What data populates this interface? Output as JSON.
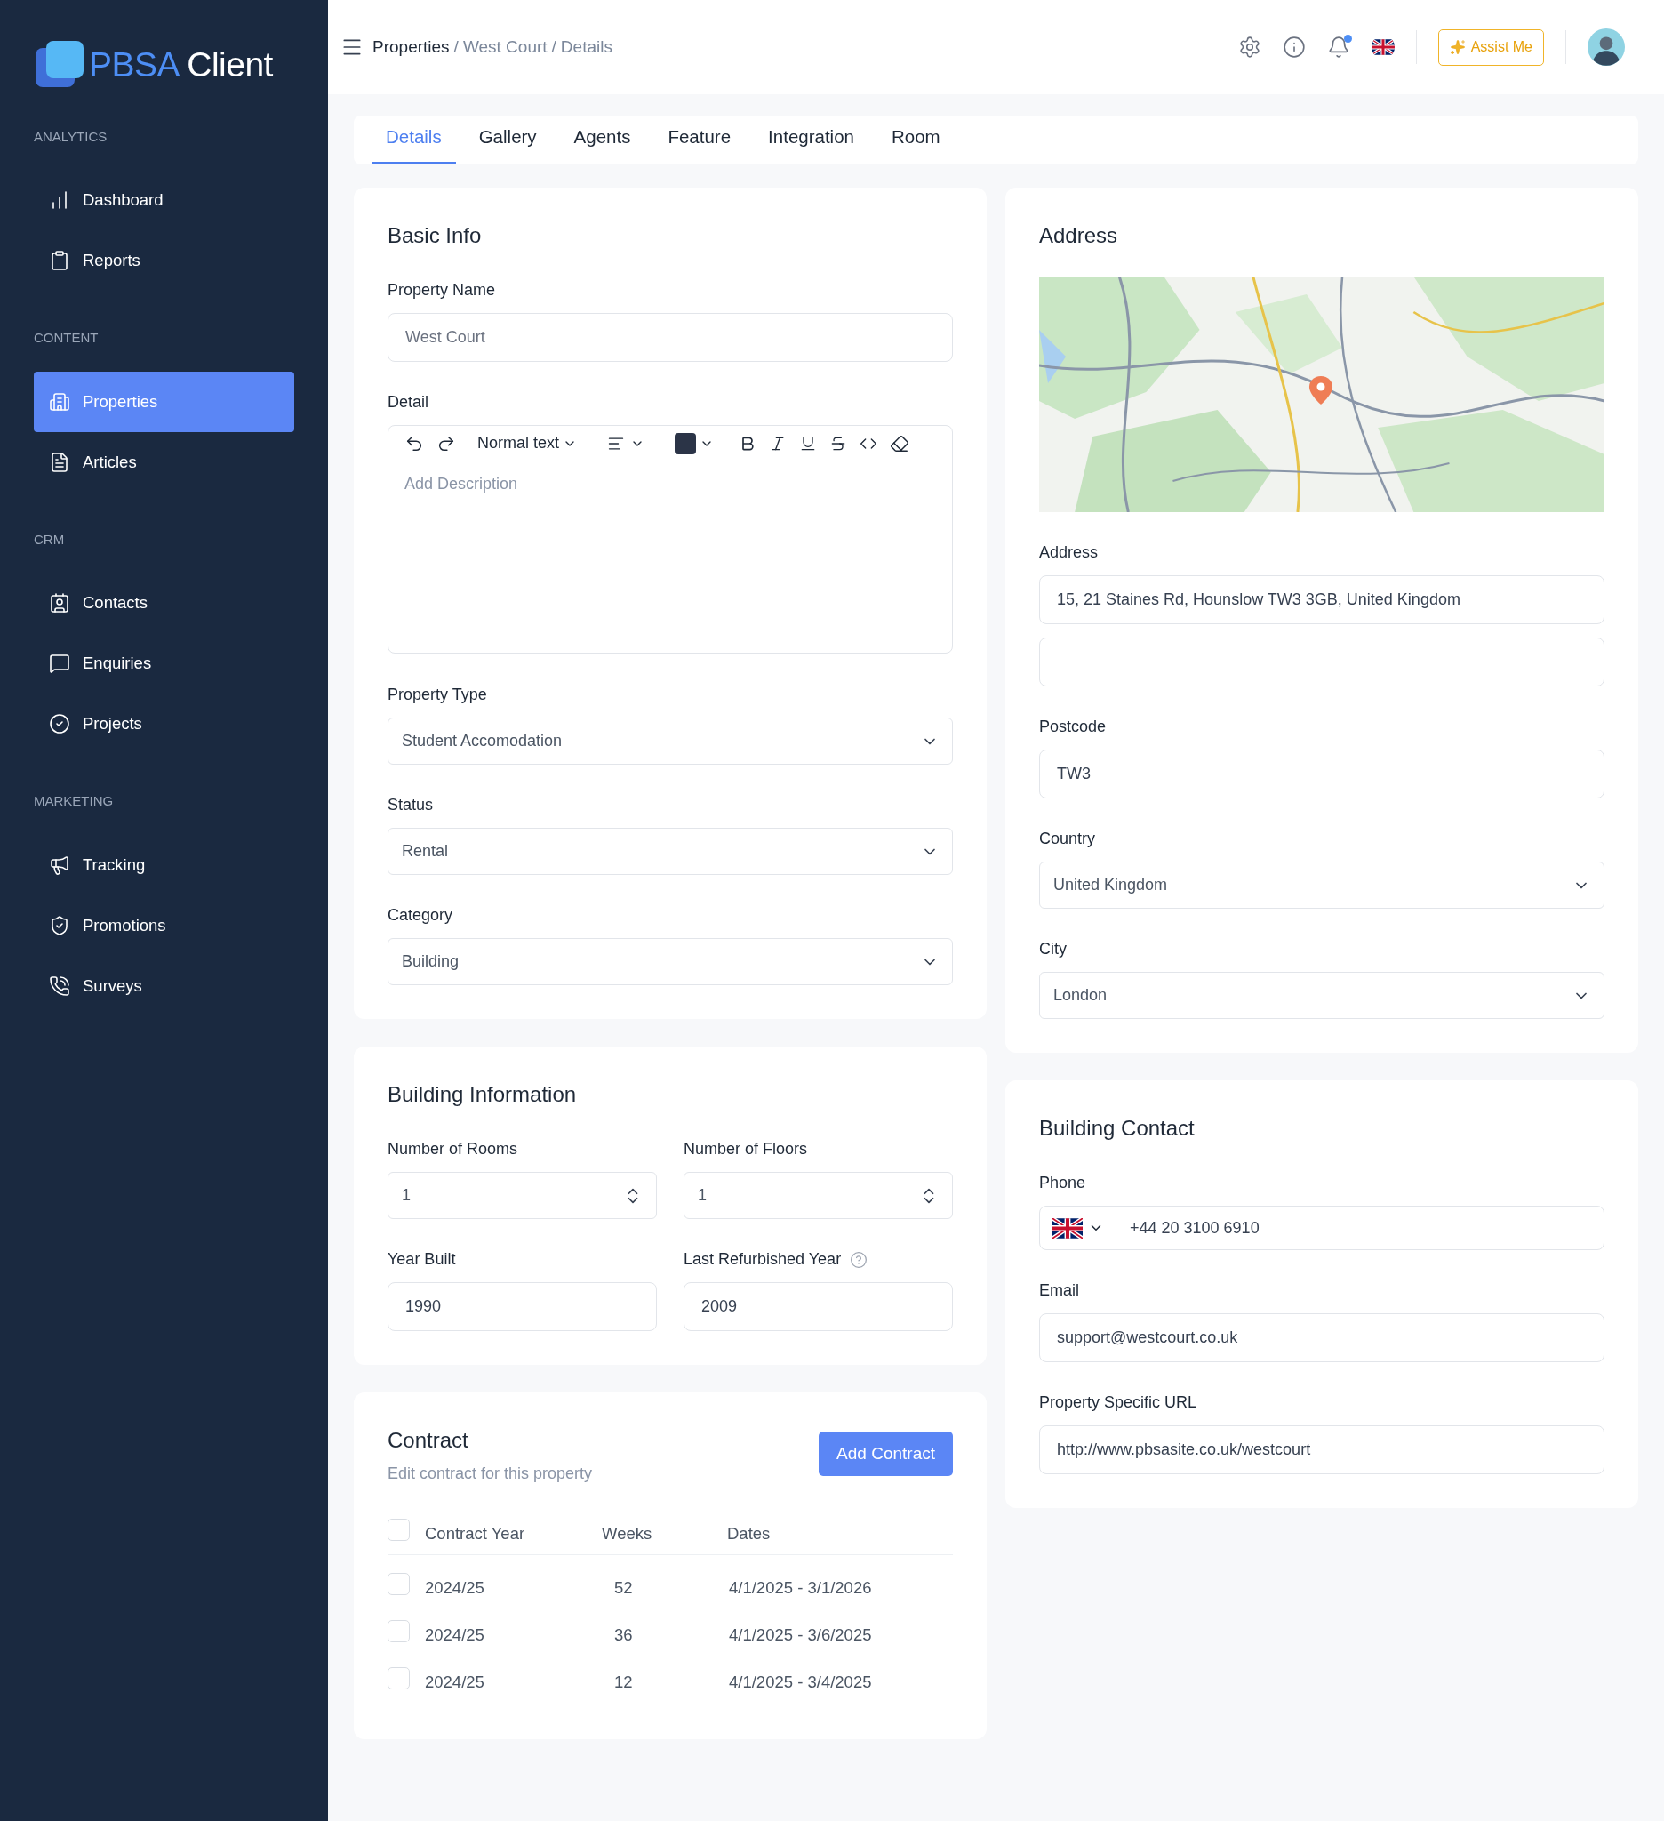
{
  "logo": {
    "primary": "PBSA",
    "secondary": "Client"
  },
  "sidebar": {
    "sections": [
      {
        "title": "ANALYTICS",
        "items": [
          {
            "label": "Dashboard",
            "selected": false
          },
          {
            "label": "Reports",
            "selected": false
          }
        ]
      },
      {
        "title": "CONTENT",
        "items": [
          {
            "label": "Properties",
            "selected": true
          },
          {
            "label": "Articles",
            "selected": false
          }
        ]
      },
      {
        "title": "CRM",
        "items": [
          {
            "label": "Contacts",
            "selected": false
          },
          {
            "label": "Enquiries",
            "selected": false
          },
          {
            "label": "Projects",
            "selected": false
          }
        ]
      },
      {
        "title": "MARKETING",
        "items": [
          {
            "label": "Tracking",
            "selected": false
          },
          {
            "label": "Promotions",
            "selected": false
          },
          {
            "label": "Surveys",
            "selected": false
          }
        ]
      }
    ]
  },
  "topbar": {
    "breadcrumb": [
      "Properties",
      "West Court",
      "Details"
    ],
    "breadcrumb_separator": "/",
    "notifications_unread": true,
    "assist_label": "Assist Me"
  },
  "tabs": [
    {
      "label": "Details",
      "selected": true
    },
    {
      "label": "Gallery",
      "selected": false
    },
    {
      "label": "Agents",
      "selected": false
    },
    {
      "label": "Feature",
      "selected": false
    },
    {
      "label": "Integration",
      "selected": false
    },
    {
      "label": "Room",
      "selected": false
    }
  ],
  "basic_info": {
    "title": "Basic Info",
    "property_name": {
      "label": "Property Name",
      "placeholder": "West Court"
    },
    "detail": {
      "label": "Detail",
      "block_style": "Normal text",
      "placeholder": "Add Description"
    },
    "selects": [
      {
        "label": "Property Type",
        "value": "Student Accomodation"
      },
      {
        "label": "Status",
        "value": "Rental"
      },
      {
        "label": "Category",
        "value": "Building"
      }
    ]
  },
  "building_information": {
    "title": "Building Information",
    "fields": [
      {
        "kind": "number",
        "label": "Number of Rooms",
        "value": "1"
      },
      {
        "kind": "number",
        "label": "Number of Floors",
        "value": "1"
      },
      {
        "kind": "text",
        "label": "Year Built",
        "value": "1990",
        "help": false
      },
      {
        "kind": "text",
        "label": "Last Refurbished Year",
        "value": "2009",
        "help": true
      }
    ]
  },
  "contract": {
    "title": "Contract",
    "subtitle": "Edit contract for this property",
    "button": "Add Contract",
    "all_checked": false,
    "columns": [
      "Contract Year",
      "Weeks",
      "Dates"
    ],
    "rows": [
      {
        "year": "2024/25",
        "weeks": "52",
        "dates": "4/1/2025 - 3/1/2026",
        "checked": false
      },
      {
        "year": "2024/25",
        "weeks": "36",
        "dates": "4/1/2025 - 3/6/2025",
        "checked": false
      },
      {
        "year": "2024/25",
        "weeks": "12",
        "dates": "4/1/2025 - 3/4/2025",
        "checked": false
      }
    ]
  },
  "address": {
    "title": "Address",
    "address_label": "Address",
    "address_lines": [
      {
        "value": "15, 21 Staines Rd, Hounslow TW3 3GB, United Kingdom"
      }
    ],
    "extra_blank_line": true,
    "postcode": {
      "label": "Postcode",
      "value": "TW3"
    },
    "selects": [
      {
        "label": "Country",
        "value": "United Kingdom"
      },
      {
        "label": "City",
        "value": "London"
      }
    ]
  },
  "building_contact": {
    "title": "Building Contact",
    "phone": {
      "label": "Phone",
      "value": "+44 20 3100 6910"
    },
    "email": {
      "label": "Email",
      "value": "support@westcourt.co.uk"
    },
    "url": {
      "label": "Property Specific URL",
      "value": "http://www.pbsasite.co.uk/westcourt"
    }
  }
}
